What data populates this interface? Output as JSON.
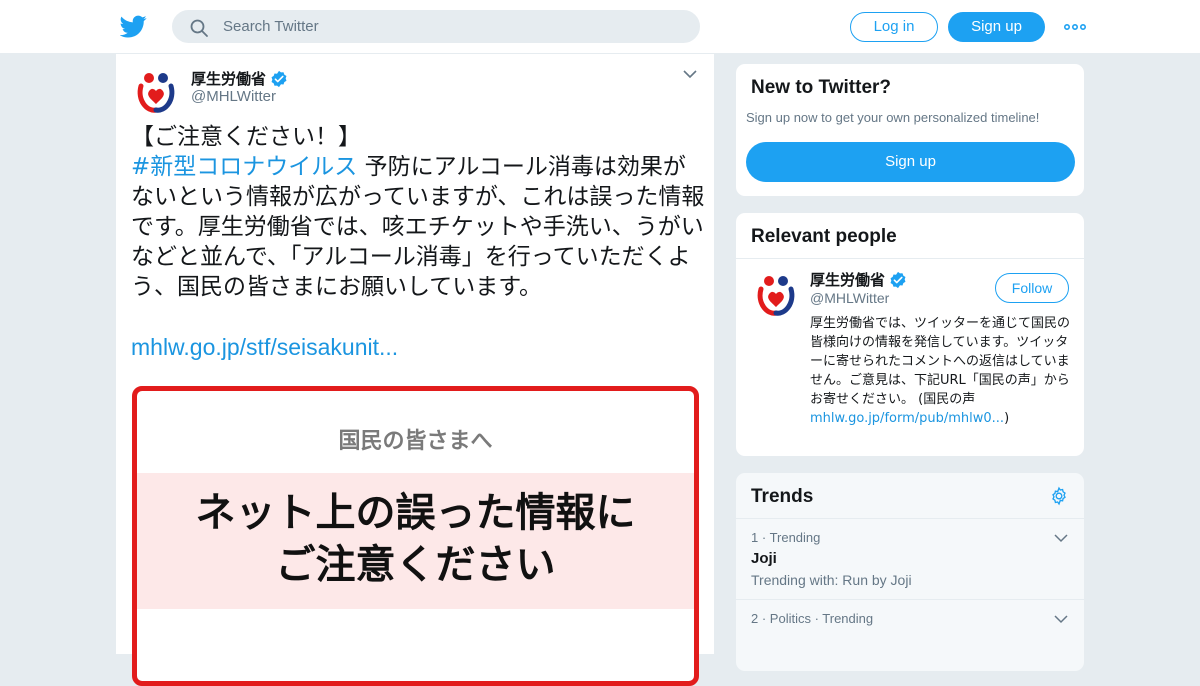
{
  "header": {
    "logo_icon": "twitter-bird-icon",
    "search_placeholder": "Search Twitter",
    "login_label": "Log in",
    "signup_label": "Sign up",
    "more_icon": "more-dots-icon"
  },
  "tweet": {
    "display_name": "厚生労働省",
    "handle": "@MHLWitter",
    "verified": true,
    "text_line1": "【ご注意ください！】",
    "hashtag": "#新型コロナウイルス",
    "text_body": " 予防にアルコール消毒は効果がないという情報が広がっていますが、これは誤った情報です。厚生労働省では、咳エチケットや手洗い、うがいなどと並んで、「アルコール消毒」を行っていただくよう、国民の皆さまにお願いしています。",
    "link": "mhlw.go.jp/stf/seisakunit...",
    "media": {
      "subtitle": "国民の皆さまへ",
      "headline_line1": "ネット上の誤った情報に",
      "headline_line2": "ご注意ください"
    }
  },
  "sidebar": {
    "new_to_twitter": {
      "title": "New to Twitter?",
      "description": "Sign up now to get your own personalized timeline!",
      "button": "Sign up"
    },
    "relevant_people": {
      "title": "Relevant people",
      "name": "厚生労働省",
      "handle": "@MHLWitter",
      "follow_label": "Follow",
      "bio": "厚生労働省では、ツイッターを通じて国民の皆様向けの情報を発信しています。ツイッターに寄せられたコメントへの返信はしていません。ご意見は、下記URL「国民の声」からお寄せください。 (国民の声 ",
      "bio_link": "mhlw.go.jp/form/pub/mhlw0...",
      "bio_end": ")"
    },
    "trends": {
      "title": "Trends",
      "items": [
        {
          "rank": "1",
          "meta": "Trending",
          "name": "Joji",
          "sub": "Trending with: Run by Joji"
        },
        {
          "rank": "2",
          "meta": "Politics · Trending",
          "name": "",
          "sub": ""
        }
      ]
    }
  },
  "colors": {
    "brand_blue": "#1da1f2",
    "link_blue": "#1b95e0",
    "alert_red": "#e21c1c"
  }
}
